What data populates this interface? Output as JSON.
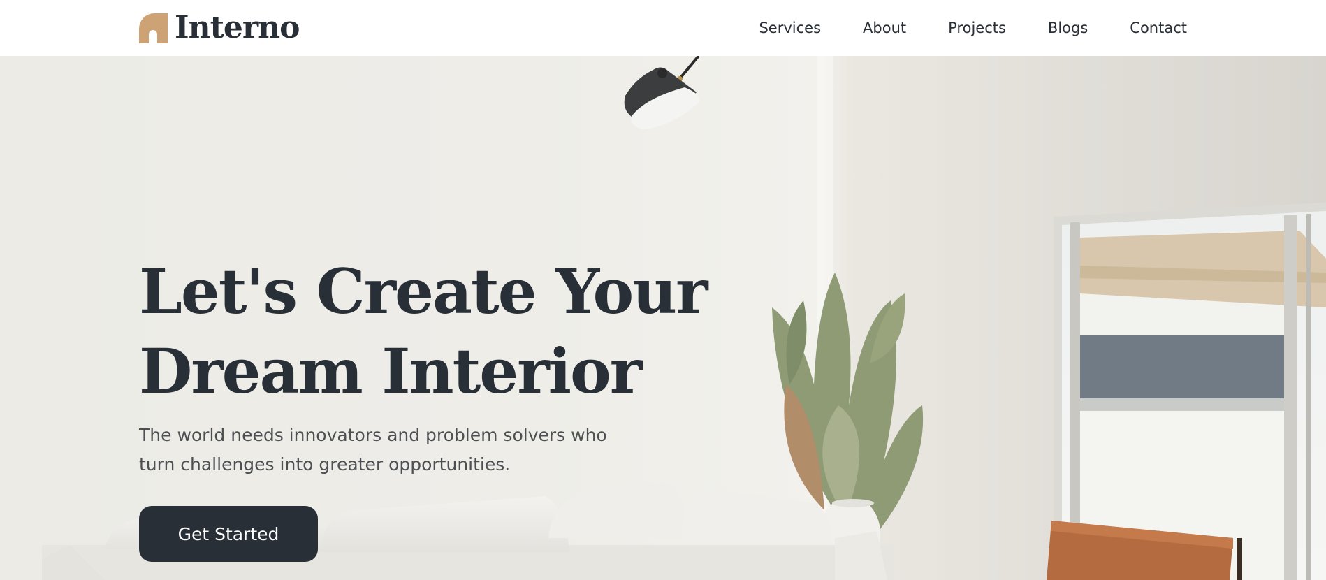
{
  "brand": {
    "name": "Interno",
    "accent_color": "#cda274",
    "dark_color": "#292f36"
  },
  "nav": {
    "items": [
      {
        "label": "Services"
      },
      {
        "label": "About"
      },
      {
        "label": "Projects"
      },
      {
        "label": "Blogs"
      },
      {
        "label": "Contact"
      }
    ]
  },
  "hero": {
    "title_line1": "Let's Create Your",
    "title_line2": "Dream Interior",
    "subtitle_line1": "The world needs innovators and problem solvers who",
    "subtitle_line2": "turn challenges into greater opportunities.",
    "cta_label": "Get Started",
    "image_description_icon": "interior-photo"
  }
}
